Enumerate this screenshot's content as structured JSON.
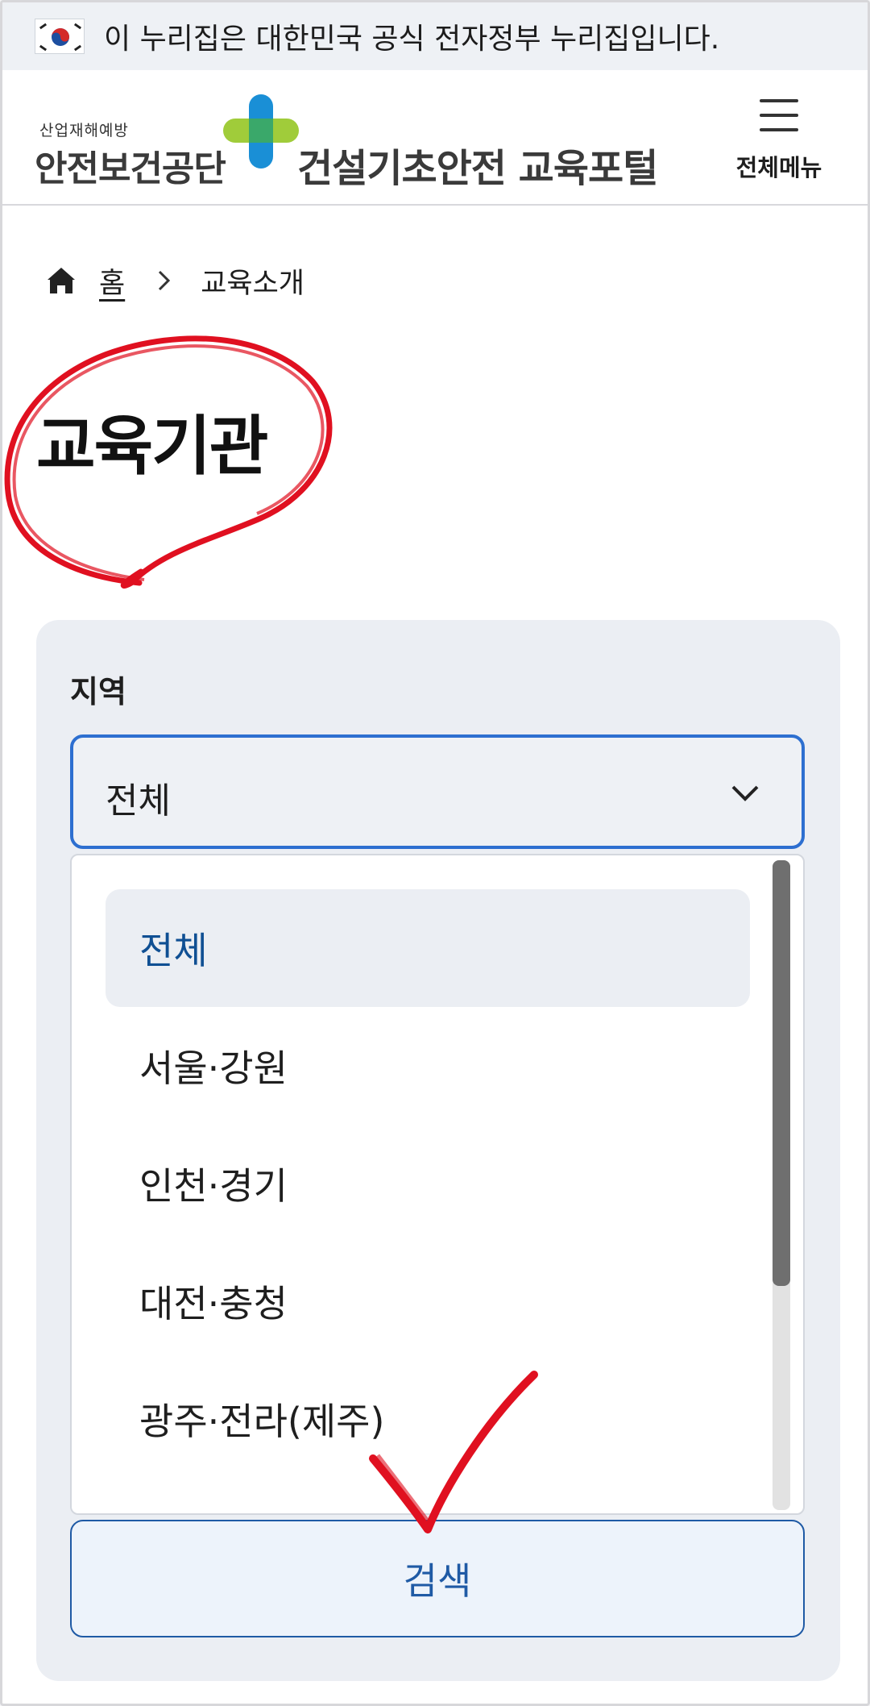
{
  "gov_banner": {
    "text": "이 누리집은 대한민국 공식 전자정부 누리집입니다."
  },
  "header": {
    "org_small": "산업재해예방",
    "org_name": "안전보건공단",
    "portal_title": "건설기초안전 교육포털",
    "menu_label": "전체메뉴"
  },
  "breadcrumb": {
    "home": "홈",
    "current": "교육소개"
  },
  "page": {
    "title": "교육기관"
  },
  "filter": {
    "label": "지역",
    "selected": "전체",
    "options": [
      {
        "label": "전체",
        "selected": true
      },
      {
        "label": "서울·강원",
        "selected": false
      },
      {
        "label": "인천·경기",
        "selected": false
      },
      {
        "label": "대전·충청",
        "selected": false
      },
      {
        "label": "광주·전라(제주)",
        "selected": false
      }
    ],
    "search_label": "검색"
  },
  "colors": {
    "accent_blue": "#2d6fd0",
    "selected_text": "#0f4f93",
    "button_blue": "#1f5aa5",
    "annotation_red": "#e01020",
    "logo_blue": "#1a8fd6",
    "logo_green": "#9bc92f"
  },
  "icons": [
    "korea-flag-icon",
    "logo-cross-icon",
    "hamburger-menu-icon",
    "home-icon",
    "chevron-right-icon",
    "chevron-down-icon"
  ]
}
